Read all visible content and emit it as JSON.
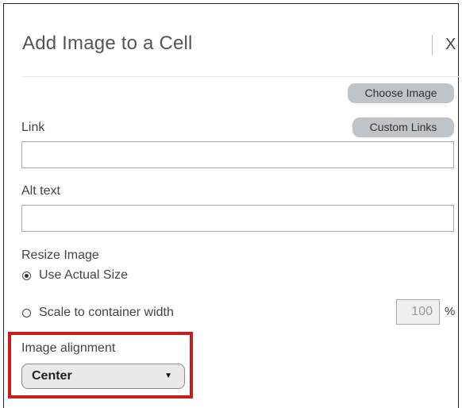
{
  "dialog": {
    "title": "Add Image to a Cell",
    "close_label": "X"
  },
  "buttons": {
    "choose_image": "Choose Image",
    "custom_links": "Custom Links"
  },
  "fields": {
    "link_label": "Link",
    "link_value": "",
    "alt_label": "Alt text",
    "alt_value": ""
  },
  "resize": {
    "label": "Resize Image",
    "options": [
      {
        "label": "Use Actual Size",
        "selected": true
      },
      {
        "label": "Scale to container width",
        "selected": false
      }
    ],
    "scale_value": "100",
    "scale_unit": "%"
  },
  "alignment": {
    "label": "Image alignment",
    "selected": "Center",
    "highlight_color": "#c81d1d"
  },
  "icons": {
    "close": "close-icon",
    "dropdown": "chevron-down-icon",
    "radio_on": "radio-selected-icon",
    "radio_off": "radio-unselected-icon"
  }
}
